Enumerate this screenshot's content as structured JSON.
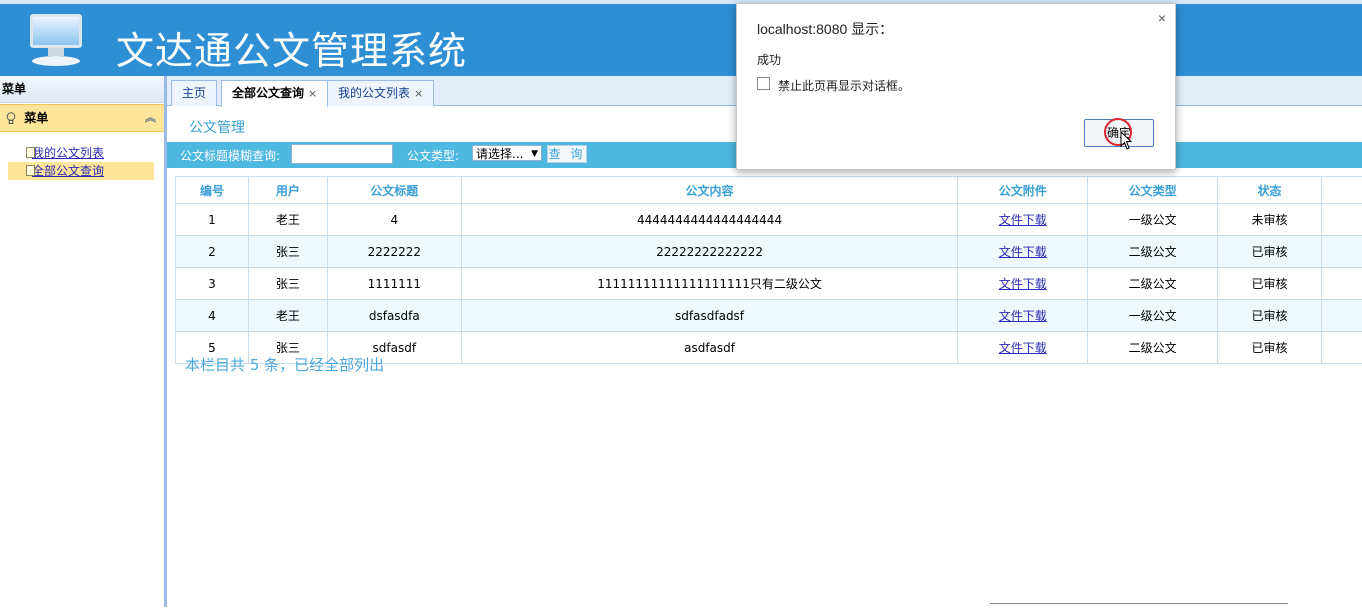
{
  "header": {
    "app_title": "文达通公文管理系统"
  },
  "sidebar": {
    "title": "菜单",
    "section_title": "菜单",
    "items": [
      {
        "label": "我的公文列表",
        "selected": false
      },
      {
        "label": "全部公文查询",
        "selected": true
      }
    ]
  },
  "tabs": [
    {
      "label": "主页",
      "closable": false,
      "active": false
    },
    {
      "label": "全部公文查询",
      "closable": true,
      "active": true
    },
    {
      "label": "我的公文列表",
      "closable": true,
      "active": false
    }
  ],
  "tab_close_glyph": "×",
  "panel": {
    "title": "公文管理",
    "search": {
      "title_label": "公文标题模糊查询:",
      "title_value": "",
      "type_label": "公文类型:",
      "type_selected": "请选择...",
      "query_button": "查 询"
    }
  },
  "table": {
    "columns": [
      "编号",
      "用户",
      "公文标题",
      "公文内容",
      "公文附件",
      "公文类型",
      "状态"
    ],
    "rows": [
      [
        "1",
        "老王",
        "4",
        "4444444444444444444",
        "文件下载",
        "一级公文",
        "未审核"
      ],
      [
        "2",
        "张三",
        "2222222",
        "22222222222222",
        "文件下载",
        "二级公文",
        "已审核"
      ],
      [
        "3",
        "张三",
        "1111111",
        "11111111111111111111只有二级公文",
        "文件下载",
        "二级公文",
        "已审核"
      ],
      [
        "4",
        "老王",
        "dsfasdfa",
        "sdfasdfadsf",
        "文件下载",
        "一级公文",
        "已审核"
      ],
      [
        "5",
        "张三",
        "sdfasdf",
        "asdfasdf",
        "文件下载",
        "二级公文",
        "已审核"
      ]
    ]
  },
  "footer_note": "本栏目共 5 条，已经全部列出",
  "dialog": {
    "title": "localhost:8080 显示：",
    "message": "成功",
    "checkbox_label": "禁止此页再显示对话框。",
    "checkbox_checked": false,
    "ok_button": "确定",
    "close_glyph": "×"
  },
  "colors": {
    "header_bg": "#2f8fd5",
    "search_bar_bg": "#4fb8e0",
    "accent_text": "#3aa0d8",
    "selected_item_bg": "#fde69a"
  }
}
